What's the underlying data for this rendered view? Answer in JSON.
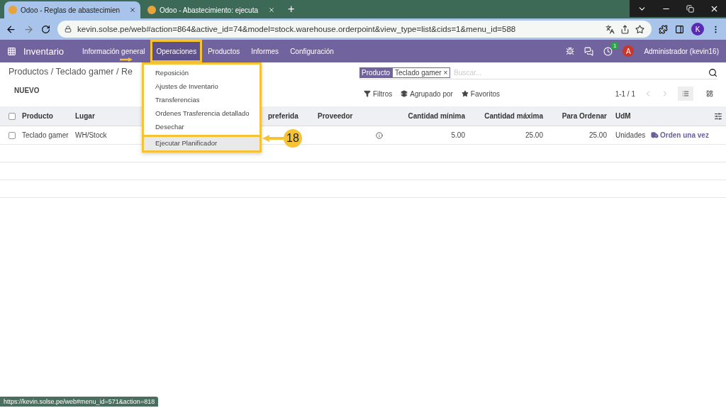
{
  "browser": {
    "tabs": [
      {
        "title": "Odoo - Reglas de abastecimien",
        "selected": true
      },
      {
        "title": "Odoo - Abastecimiento: ejecuta",
        "selected": false
      }
    ],
    "new_tab": "+",
    "address": "kevin.solse.pe/web#action=864&active_id=74&model=stock.warehouse.orderpoint&view_type=list&cids=1&menu_id=588",
    "profile_initial": "K"
  },
  "navbar": {
    "app_name": "Inventario",
    "menu": [
      {
        "label": "Información general",
        "selected": false
      },
      {
        "label": "Operaciones",
        "selected": true
      },
      {
        "label": "Productos",
        "selected": false
      },
      {
        "label": "Informes",
        "selected": false
      },
      {
        "label": "Configuración",
        "selected": false
      }
    ],
    "activity_count": "1",
    "user_initial": "A",
    "user_name": "Administrador (kevin16)"
  },
  "dropdown": {
    "items": [
      {
        "label": "Reposición",
        "selected": false
      },
      {
        "label": "Ajustes de Inventario",
        "selected": false
      },
      {
        "label": "Transferencias",
        "selected": false
      },
      {
        "label": "Ordenes Trasferencia detallado",
        "selected": false
      },
      {
        "label": "Desechar",
        "selected": false
      },
      {
        "label": "Ejecutar Planificador",
        "selected": true
      }
    ],
    "step": "18"
  },
  "breadcrumb": "Productos / Teclado gamer / Re",
  "new_button": "NUEVO",
  "search": {
    "facet_field": "Producto",
    "facet_value": "Teclado gamer",
    "facet_remove": "×",
    "placeholder": "Buscar..."
  },
  "filters": [
    "Filtros",
    "Agrupado por",
    "Favoritos"
  ],
  "pager": "1-1 / 1",
  "views": [
    {
      "kind": "list",
      "selected": true
    },
    {
      "kind": "kanban",
      "selected": false
    }
  ],
  "table": {
    "columns": [
      "Producto",
      "Lugar",
      "",
      "preferida",
      "Proveedor",
      "",
      "Cantidad mínima",
      "Cantidad máxima",
      "Para Ordenar",
      "UdM",
      ""
    ],
    "rows": [
      {
        "checked": false,
        "cells": [
          "Teclado gamer",
          "WH/Stock",
          "",
          "",
          "",
          "",
          "5.00",
          "25.00",
          "25.00",
          "Unidades"
        ],
        "action": "Orden una vez"
      }
    ]
  },
  "header_checked": false,
  "status_url": "https://kevin.solse.pe/web#menu_id=571&action=818"
}
